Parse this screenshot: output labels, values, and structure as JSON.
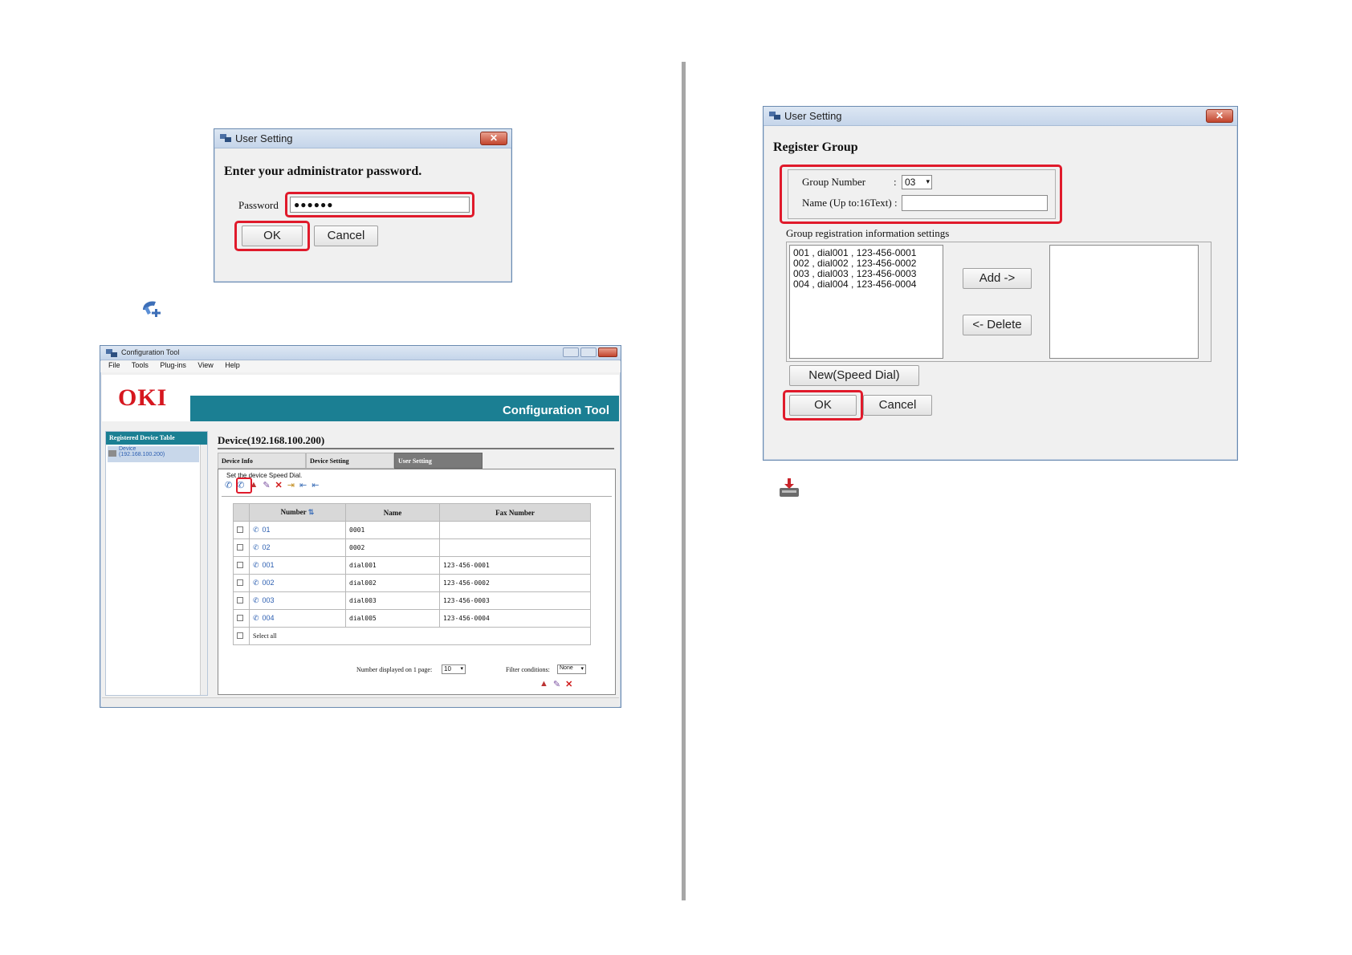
{
  "left_password_dialog": {
    "title": "User Setting",
    "close_glyph": "✕",
    "prompt": "Enter your administrator password.",
    "password_label": "Password",
    "password_value": "●●●●●●",
    "ok_label": "OK",
    "cancel_label": "Cancel"
  },
  "config_tool": {
    "title": "Configuration Tool",
    "menu": [
      "File",
      "Tools",
      "Plug-ins",
      "View",
      "Help"
    ],
    "logo": "OKI",
    "banner_title": "Configuration Tool",
    "sidebar_header": "Registered Device Table",
    "sidebar_device_line1": "Device",
    "sidebar_device_line2": "(192.168.100.200)",
    "device_heading": "Device(192.168.100.200)",
    "tabs": [
      "Device Info",
      "Device Setting",
      "User Setting"
    ],
    "section_label": "Set the device Speed Dial.",
    "table": {
      "headers": [
        "Number",
        "Name",
        "Fax Number"
      ],
      "rows": [
        {
          "number": "01",
          "name": "0001",
          "fax": "",
          "type": "group"
        },
        {
          "number": "02",
          "name": "0002",
          "fax": "",
          "type": "group"
        },
        {
          "number": "001",
          "name": "dial001",
          "fax": "123-456-0001",
          "type": "dial"
        },
        {
          "number": "002",
          "name": "dial002",
          "fax": "123-456-0002",
          "type": "dial"
        },
        {
          "number": "003",
          "name": "dial003",
          "fax": "123-456-0003",
          "type": "dial"
        },
        {
          "number": "004",
          "name": "dial005",
          "fax": "123-456-0004",
          "type": "dial"
        }
      ],
      "select_all": "Select all"
    },
    "per_page_label": "Number displayed on 1 page:",
    "per_page_value": "10",
    "filter_label": "Filter conditions:",
    "filter_value": "None"
  },
  "register_group_dialog": {
    "title": "User Setting",
    "close_glyph": "✕",
    "heading": "Register Group",
    "group_number_label": "Group Number",
    "group_number_sep": ":",
    "group_number_value": "03",
    "name_label": "Name (Up to:16Text) :",
    "name_value": "",
    "settings_label": "Group registration information settings",
    "available_list": [
      "001 , dial001 , 123-456-0001",
      "002 , dial002 , 123-456-0002",
      "003 , dial003 , 123-456-0003",
      "004 , dial004 , 123-456-0004"
    ],
    "add_label": "Add ->",
    "delete_label": "<- Delete",
    "new_speed_dial_label": "New(Speed Dial)",
    "ok_label": "OK",
    "cancel_label": "Cancel"
  },
  "icons": {
    "add_group_icon": "phone-plus-icon",
    "register_icon": "register-download-icon"
  }
}
